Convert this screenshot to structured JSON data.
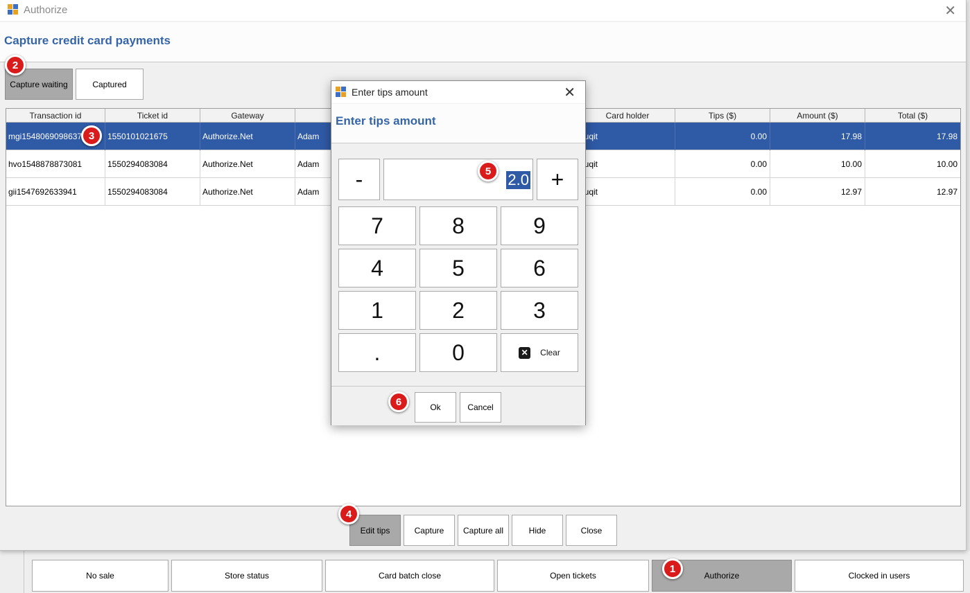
{
  "window": {
    "title": "Authorize",
    "close_glyph": "✕",
    "header_title": "Capture credit card payments"
  },
  "tabs": [
    {
      "label": "Capture waiting",
      "selected": true
    },
    {
      "label": "Captured",
      "selected": false
    }
  ],
  "table": {
    "columns": [
      "Transaction id",
      "Ticket id",
      "Gateway",
      "",
      "",
      "",
      "Card holder",
      "Tips ($)",
      "Amount ($)",
      "Total ($)"
    ],
    "rows": [
      {
        "transaction_id": "mgi1548069098637",
        "ticket_id": "1550101021675",
        "gateway": "Authorize.Net",
        "user": "Adam",
        "card_holder": "luqit",
        "tips": "0.00",
        "amount": "17.98",
        "total": "17.98",
        "selected": true
      },
      {
        "transaction_id": "hvo1548878873081",
        "ticket_id": "1550294083084",
        "gateway": "Authorize.Net",
        "user": "Adam",
        "card_holder": "luqit",
        "tips": "0.00",
        "amount": "10.00",
        "total": "10.00",
        "selected": false
      },
      {
        "transaction_id": "gii1547692633941",
        "ticket_id": "1550294083084",
        "gateway": "Authorize.Net",
        "user": "Adam",
        "card_holder": "luqit",
        "tips": "0.00",
        "amount": "12.97",
        "total": "12.97",
        "selected": false
      }
    ]
  },
  "actions": {
    "edit_tips": "Edit tips",
    "capture": "Capture",
    "capture_all": "Capture all",
    "hide": "Hide",
    "close": "Close"
  },
  "bottom_bar": {
    "no_sale": "No sale",
    "store_status": "Store status",
    "card_batch_close": "Card batch close",
    "open_tickets": "Open tickets",
    "authorize": "Authorize",
    "clocked_in_users": "Clocked in users"
  },
  "dialog": {
    "title": "Enter tips amount",
    "close_glyph": "✕",
    "header_title": "Enter tips amount",
    "minus": "-",
    "plus": "+",
    "value": "2.0",
    "keys": {
      "k7": "7",
      "k8": "8",
      "k9": "9",
      "k4": "4",
      "k5": "5",
      "k6": "6",
      "k1": "1",
      "k2": "2",
      "k3": "3",
      "dot": ".",
      "k0": "0"
    },
    "clear_label": "Clear",
    "ok": "Ok",
    "cancel": "Cancel"
  },
  "annotations": {
    "b1": "1",
    "b2": "2",
    "b3": "3",
    "b4": "4",
    "b5": "5",
    "b6": "6"
  },
  "colors": {
    "accent_title": "#3565a8",
    "selection": "#2f5aa6",
    "badge": "#d91b1b",
    "pressed_button": "#a9a9a9"
  },
  "icons": {
    "app": "pos-app-icon",
    "clear": "clear-x-icon",
    "close": "close-icon"
  }
}
